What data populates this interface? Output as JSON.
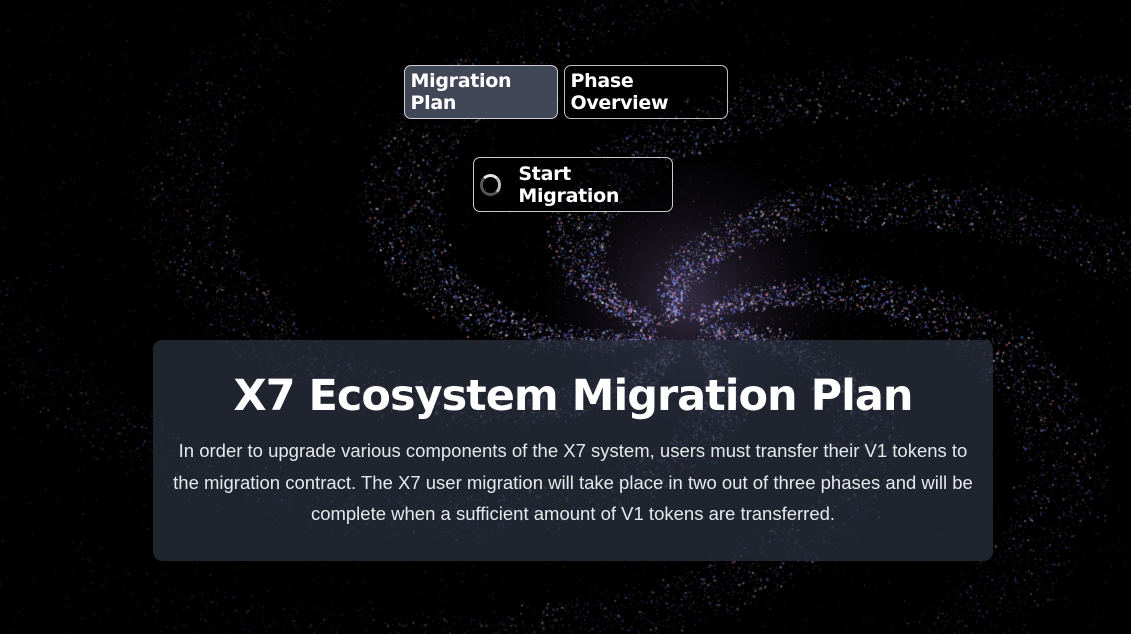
{
  "tabs": [
    {
      "label": "Migration Plan",
      "active": true
    },
    {
      "label": "Phase Overview",
      "active": false
    }
  ],
  "actions": {
    "start_label": "Start Migration",
    "start_icon": "loading-spinner-icon"
  },
  "hero": {
    "title": "X7 Ecosystem Migration Plan",
    "description": "In order to upgrade various components of the X7 system, users must transfer their V1 tokens to the migration contract. The X7 user migration will take place in two out of three phases and will be complete when a sufficient amount of V1 tokens are transferred."
  },
  "colors": {
    "background": "#000000",
    "active_tab": "#414756",
    "card": "#282e3c",
    "galaxy_blue": "#5a7dff",
    "galaxy_pink": "#ff8fa0",
    "galaxy_purple": "#8a5cff"
  }
}
